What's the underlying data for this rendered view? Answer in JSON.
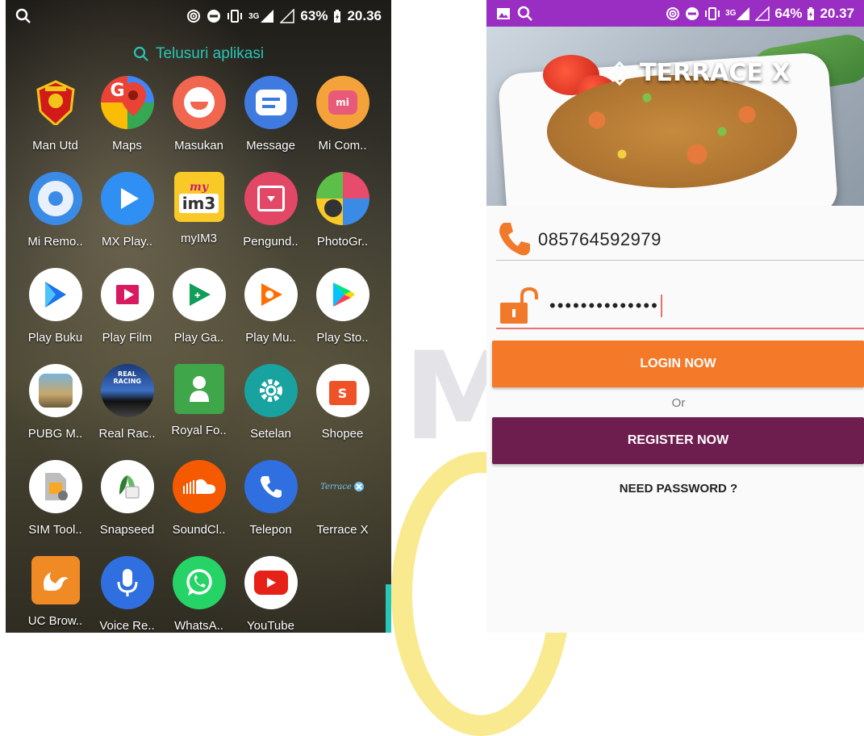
{
  "left_phone": {
    "status": {
      "left_icon": "search-icon",
      "network": "3G",
      "battery": "63%",
      "time": "20.36"
    },
    "search_placeholder": "Telusuri aplikasi",
    "apps": [
      {
        "label": "Man Utd",
        "icon": "man-utd-icon"
      },
      {
        "label": "Maps",
        "icon": "maps-icon"
      },
      {
        "label": "Masukan",
        "icon": "masukan-icon"
      },
      {
        "label": "Message",
        "icon": "message-icon"
      },
      {
        "label": "Mi Com..",
        "icon": "mi-community-icon"
      },
      {
        "label": "Mi Remo..",
        "icon": "mi-remote-icon"
      },
      {
        "label": "MX Play..",
        "icon": "mx-player-icon"
      },
      {
        "label": "myIM3",
        "icon": "myim3-icon"
      },
      {
        "label": "Pengund..",
        "icon": "downloads-icon"
      },
      {
        "label": "PhotoGr..",
        "icon": "photogrid-icon"
      },
      {
        "label": "Play Buku",
        "icon": "play-books-icon"
      },
      {
        "label": "Play Film",
        "icon": "play-movies-icon"
      },
      {
        "label": "Play Ga..",
        "icon": "play-games-icon"
      },
      {
        "label": "Play Mu..",
        "icon": "play-music-icon"
      },
      {
        "label": "Play Sto..",
        "icon": "play-store-icon"
      },
      {
        "label": "PUBG M..",
        "icon": "pubg-icon"
      },
      {
        "label": "Real Rac..",
        "icon": "real-racing-icon"
      },
      {
        "label": "Royal Fo..",
        "icon": "royal-fo-icon"
      },
      {
        "label": "Setelan",
        "icon": "settings-icon"
      },
      {
        "label": "Shopee",
        "icon": "shopee-icon"
      },
      {
        "label": "SIM Tool..",
        "icon": "sim-toolkit-icon"
      },
      {
        "label": "Snapseed",
        "icon": "snapseed-icon"
      },
      {
        "label": "SoundCl..",
        "icon": "soundcloud-icon"
      },
      {
        "label": "Telepon",
        "icon": "phone-icon"
      },
      {
        "label": "Terrace X",
        "icon": "terrace-x-icon"
      },
      {
        "label": "UC Brow..",
        "icon": "uc-browser-icon"
      },
      {
        "label": "Voice Re..",
        "icon": "voice-recorder-icon"
      },
      {
        "label": "WhatsA..",
        "icon": "whatsapp-icon"
      },
      {
        "label": "YouTube",
        "icon": "youtube-icon"
      }
    ],
    "icon_texts": {
      "mi": "mi",
      "myim3_top": "my",
      "myim3_bottom": "im3",
      "real_racing": "REAL RACING",
      "terrace": "Terrace",
      "shopee": "S"
    }
  },
  "right_phone": {
    "status": {
      "network": "3G",
      "battery": "64%",
      "time": "20.37"
    },
    "hero_title": "TERRACE X",
    "phone_value": "085764592979",
    "password_mask": "••••••••••••••",
    "login_label": "LOGIN NOW",
    "or_label": "Or",
    "register_label": "REGISTER NOW",
    "need_password_label": "NEED PASSWORD ?",
    "colors": {
      "status_bar": "#9a2ec3",
      "login": "#f47a2a",
      "register": "#6e1e4e",
      "accent_orange": "#f07a2a"
    }
  }
}
